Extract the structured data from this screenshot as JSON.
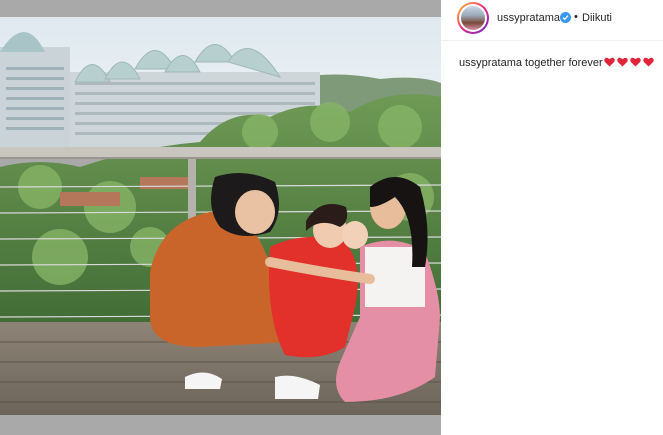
{
  "post": {
    "username": "ussypratama",
    "separator": "•",
    "follow_status": "Diikuti",
    "verified": true,
    "accent": "#3897f0"
  },
  "caption": {
    "username": "ussypratama",
    "text": "together forever",
    "emoji": [
      "red-heart-icon",
      "red-heart-icon",
      "red-heart-icon",
      "red-heart-icon"
    ],
    "heart_color": "#e0243a"
  },
  "photo": {
    "subject": "photo"
  }
}
